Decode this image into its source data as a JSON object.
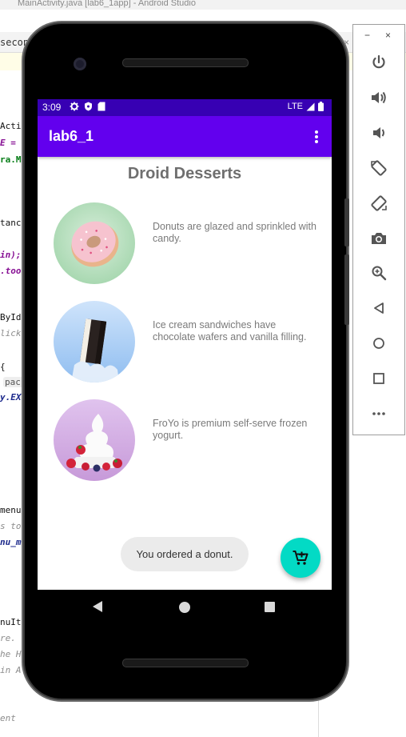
{
  "ide": {
    "window_title": "MainActivity.java [lab6_1app] - Android Studio",
    "tab_label": "second",
    "tab_close": "×",
    "code_lines": [
      {
        "prefix": "",
        "highlight": "Activ",
        "style": "plain"
      },
      {
        "prefix": "",
        "highlight": "E =",
        "style": "purple"
      },
      {
        "prefix": "",
        "highlight": "ra.ME",
        "style": "green"
      },
      {
        "prefix": "",
        "highlight": "tance",
        "style": "plain"
      },
      {
        "prefix": "",
        "highlight": "in);",
        "style": "purple"
      },
      {
        "prefix": "",
        "highlight": ".tool",
        "style": "purple"
      },
      {
        "prefix": "",
        "highlight": "ById",
        "style": "plain"
      },
      {
        "prefix": "",
        "highlight": "lick",
        "style": "gray"
      },
      {
        "prefix": "",
        "highlight": "{",
        "style": "plain"
      },
      {
        "prefix": "",
        "highlight": "pack",
        "style": "box"
      },
      {
        "prefix": "",
        "highlight": "y.EXT",
        "style": "navy"
      },
      {
        "prefix": "",
        "highlight": "menu",
        "style": "plain"
      },
      {
        "prefix": "",
        "highlight": "s to",
        "style": "gray"
      },
      {
        "prefix": "",
        "highlight": "nu_me",
        "style": "navy"
      },
      {
        "prefix": "",
        "highlight": "nuIte",
        "style": "plain"
      },
      {
        "prefix": "",
        "highlight": "re. T",
        "style": "gray"
      },
      {
        "prefix": "",
        "highlight": "he Ho",
        "style": "gray"
      },
      {
        "prefix": "",
        "highlight": " in A",
        "style": "gray"
      },
      {
        "prefix": "",
        "highlight": "ent",
        "style": "gray"
      }
    ]
  },
  "emulator_panel": {
    "minimize": "−",
    "close": "×",
    "buttons": [
      {
        "name": "power-icon"
      },
      {
        "name": "volume-up-icon"
      },
      {
        "name": "volume-down-icon"
      },
      {
        "name": "rotate-left-icon"
      },
      {
        "name": "rotate-right-icon"
      },
      {
        "name": "camera-icon"
      },
      {
        "name": "zoom-icon"
      },
      {
        "name": "back-icon"
      },
      {
        "name": "home-icon"
      },
      {
        "name": "overview-icon"
      },
      {
        "name": "more-icon"
      }
    ]
  },
  "status_bar": {
    "time": "3:09",
    "network": "LTE"
  },
  "app_bar": {
    "title": "lab6_1"
  },
  "content": {
    "title": "Droid Desserts",
    "desserts": [
      {
        "name": "donut",
        "description": "Donuts are glazed and sprinkled with candy."
      },
      {
        "name": "ice-cream-sandwich",
        "description": "Ice cream sandwiches have chocolate wafers and vanilla filling."
      },
      {
        "name": "froyo",
        "description": "FroYo is premium self-serve frozen yogurt."
      }
    ]
  },
  "toast": {
    "message": "You ordered a donut."
  },
  "colors": {
    "status_bar": "#3700b3",
    "app_bar": "#6200ee",
    "fab": "#03dac5"
  }
}
